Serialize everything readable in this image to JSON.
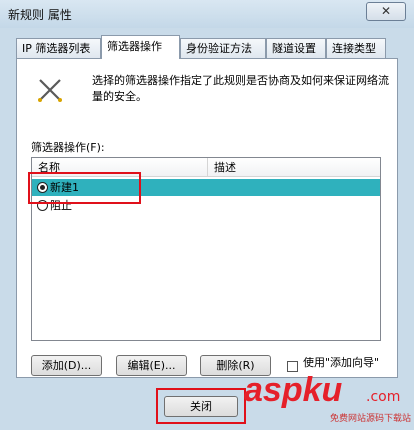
{
  "window": {
    "title": "新规则 属性",
    "close_glyph": "✕"
  },
  "tabs": [
    {
      "label": "IP 筛选器列表",
      "active": false
    },
    {
      "label": "筛选器操作",
      "active": true
    },
    {
      "label": "身份验证方法",
      "active": false
    },
    {
      "label": "隧道设置",
      "active": false
    },
    {
      "label": "连接类型",
      "active": false
    }
  ],
  "panel": {
    "description": "选择的筛选器操作指定了此规则是否协商及如何来保证网络流量的安全。",
    "section_label": "筛选器操作(F):",
    "columns": [
      "名称",
      "描述"
    ],
    "rows": [
      {
        "name": "新建1",
        "selected": true
      },
      {
        "name": "阻止",
        "selected": false
      }
    ],
    "buttons": {
      "add": "添加(D)...",
      "edit": "编辑(E)...",
      "delete": "删除(R)"
    },
    "use_wizard_label": "使用\"添加向导\"",
    "use_wizard_checked": false
  },
  "footer": {
    "close": "关闭"
  },
  "watermark": {
    "logo": "aspku",
    "suffix": ".com",
    "subtitle": "免费网站源码下载站"
  },
  "colors": {
    "selection": "#2fb1bd",
    "highlight": "#e0101a",
    "watermark": "#e5202a"
  }
}
